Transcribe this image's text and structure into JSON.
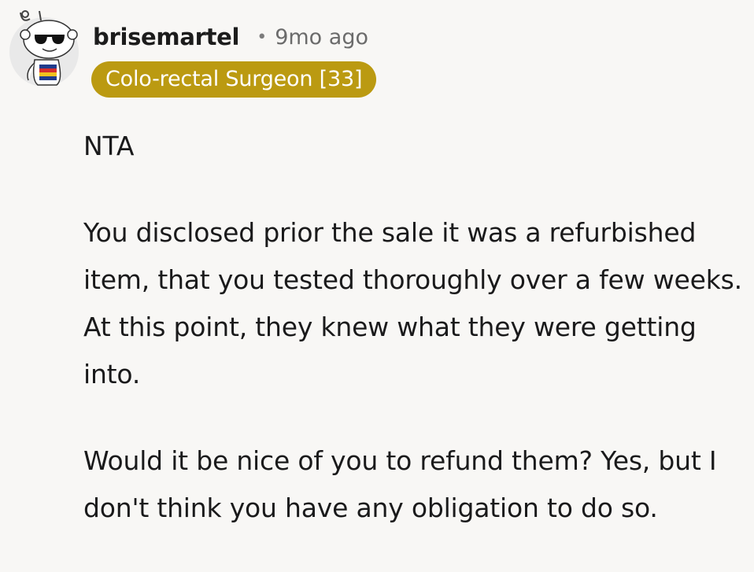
{
  "comment": {
    "author": "brisemartel",
    "separator": "•",
    "time_ago": "9mo ago",
    "flair": "Colo-rectal Surgeon [33]",
    "avatar_icon": "snoo-sunglasses-avatar-icon",
    "flair_color": "#bb9a11",
    "paragraphs": [
      "NTA",
      "You disclosed prior the sale it was a refurbished item, that you tested thoroughly over a few weeks. At this point, they knew what they were getting into.",
      "Would it be nice of you to refund them? Yes, but I don't think you have any obligation to do so."
    ]
  }
}
